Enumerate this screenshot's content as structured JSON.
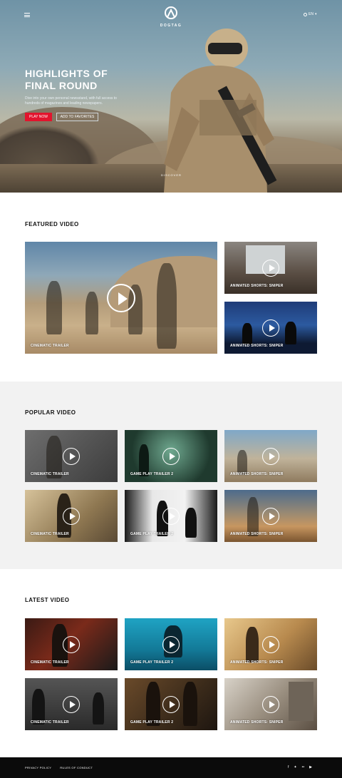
{
  "header": {
    "menu_icon": "hamburger-icon",
    "logo_text": "DOGTAG",
    "language": "EN",
    "language_icon": "globe-icon"
  },
  "hero": {
    "title_line1": "HIGHLIGHTS OF",
    "title_line2": "FINAL ROUND",
    "description": "Dive into your own personal newsstand, with full access to hundreds of magazines and leading newspapers.",
    "play_label": "PLAY NOW",
    "favorites_label": "ADD TO FAVORITES",
    "discover_label": "DISCOVER",
    "accent_color": "#e2142d"
  },
  "featured": {
    "title": "FEATURED VIDEO",
    "main": {
      "caption": "CINEMATIC TRAILER"
    },
    "side": [
      {
        "caption": "ANIMATED SHORTS: SNIPER"
      },
      {
        "caption": "ANIMATED SHORTS: SNIPER"
      }
    ]
  },
  "popular": {
    "title": "POPULAR VIDEO",
    "items": [
      {
        "caption": "CINEMATIC TRAILER"
      },
      {
        "caption": "GAME PLAY TRAILER 2"
      },
      {
        "caption": "ANIMATED SHORTS: SNIPER"
      },
      {
        "caption": "CINEMATIC TRAILER"
      },
      {
        "caption": "GAME PLAY TRAILER 2"
      },
      {
        "caption": "ANIMATED SHORTS: SNIPER"
      }
    ]
  },
  "latest": {
    "title": "LATEST VIDEO",
    "items": [
      {
        "caption": "CINEMATIC TRAILER"
      },
      {
        "caption": "GAME PLAY TRAILER 2"
      },
      {
        "caption": "ANIMATED SHORTS: SNIPER"
      },
      {
        "caption": "CINEMATIC TRAILER"
      },
      {
        "caption": "GAME PLAY TRAILER 2"
      },
      {
        "caption": "ANIMATED SHORTS: SNIPER"
      }
    ]
  },
  "footer": {
    "privacy": "PRIVACY POLICY",
    "rules": "RULES OF CONDUCT",
    "social_icons": [
      "facebook-icon",
      "twitter-icon",
      "flickr-icon",
      "youtube-icon"
    ]
  }
}
